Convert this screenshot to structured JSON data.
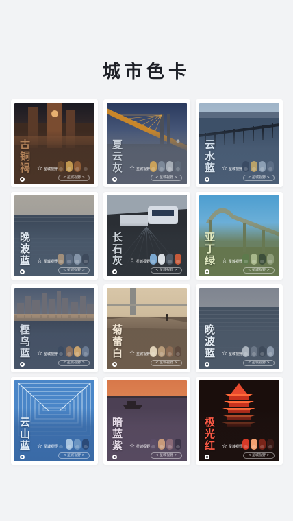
{
  "page": {
    "title": "城市色卡"
  },
  "brand": {
    "logo_text": "星城视野",
    "pill_text": "< 星城视野 >"
  },
  "cards": [
    {
      "name": "古铜褐",
      "text_color": "#b3835a",
      "swatches": [
        "#6b4a2e",
        "#c0974f",
        "#8d5b36",
        "#4a3325"
      ],
      "sky_top": "#1a1a22",
      "sky_bottom": "#6a4a3a",
      "ground": "#3d2a20",
      "overlay": "#4a3427",
      "icon": "clock-tower-scene"
    },
    {
      "name": "夏云灰",
      "text_color": "#c7cfd8",
      "swatches": [
        "#c9a15a",
        "#7c8898",
        "#a6adb6",
        "#5f6978"
      ],
      "sky_top": "#2a3a5e",
      "sky_bottom": "#7c8ca8",
      "ground": "#46505e",
      "overlay": "#5a6170",
      "icon": "bridge-scene"
    },
    {
      "name": "云水蓝",
      "text_color": "#d6e2ee",
      "swatches": [
        "#3a4b63",
        "#b8a169",
        "#8c9fb4",
        "#5b6d85"
      ],
      "sky_top": "#9fb4c8",
      "sky_bottom": "#cdd8e2",
      "ground": "#3d5068",
      "overlay": "#4a5d75",
      "icon": "pier-scene"
    },
    {
      "name": "晚波蓝",
      "text_color": "#e4ecf4",
      "swatches": [
        "#a08e7a",
        "#5c6b80",
        "#8494a8",
        "#3e4a5c"
      ],
      "sky_top": "#a8a49c",
      "sky_bottom": "#8d8f92",
      "ground": "#3e4b5c",
      "overlay": "#4b5a6c",
      "icon": "water-scene"
    },
    {
      "name": "长石灰",
      "text_color": "#cfd6dc",
      "swatches": [
        "#7ba8d0",
        "#d8dde2",
        "#4f5a66",
        "#c65a3a"
      ],
      "sky_top": "#1a1e24",
      "sky_bottom": "#5e6670",
      "ground": "#2a2e34",
      "overlay": "#2f343a",
      "icon": "metro-scene"
    },
    {
      "name": "亚丁绿",
      "text_color": "#dfe8c0",
      "swatches": [
        "#5d7a4c",
        "#a7b78a",
        "#3c4f3a",
        "#8d9c78"
      ],
      "sky_top": "#4d9ed0",
      "sky_bottom": "#a6cfe6",
      "ground": "#5c6e4a",
      "overlay": "#66774f",
      "icon": "viaduct-scene"
    },
    {
      "name": "樫鸟蓝",
      "text_color": "#d3dbe6",
      "swatches": [
        "#3d4c62",
        "#8a7160",
        "#c9a36d",
        "#6a7a92"
      ],
      "sky_top": "#4c5a70",
      "sky_bottom": "#a8a2a0",
      "ground": "#3b4556",
      "overlay": "#475468",
      "icon": "skyline-scene"
    },
    {
      "name": "菊蕾白",
      "text_color": "#f0e4d2",
      "swatches": [
        "#e0d2b8",
        "#b89c7a",
        "#8c6c54",
        "#5e4a3e"
      ],
      "sky_top": "#d8c6a8",
      "sky_bottom": "#bca886",
      "ground": "#6a5a4a",
      "overlay": "#6d5c4c",
      "icon": "riverside-scene"
    },
    {
      "name": "晚波蓝",
      "text_color": "#e4ecf4",
      "swatches": [
        "#a9b2bc",
        "#6a7686",
        "#3f4b5b",
        "#8896a8"
      ],
      "sky_top": "#7f8590",
      "sky_bottom": "#a2a4a8",
      "ground": "#455262",
      "overlay": "#4c5969",
      "icon": "water-scene"
    },
    {
      "name": "云山蓝",
      "text_color": "#e2eef8",
      "swatches": [
        "#3a6da8",
        "#a6c4e0",
        "#6b95c2",
        "#2a4a78"
      ],
      "sky_top": "#4a86c8",
      "sky_bottom": "#8ab8e4",
      "ground": "#2f5c94",
      "overlay": "#3a6aa6",
      "icon": "truss-scene"
    },
    {
      "name": "暗蓝紫",
      "text_color": "#e6dce8",
      "swatches": [
        "#5a4c66",
        "#c89a7a",
        "#8a6a78",
        "#3c3448"
      ],
      "sky_top": "#d8784a",
      "sky_bottom": "#e8a46a",
      "ground": "#4c4054",
      "overlay": "#574a60",
      "icon": "sunset-scene"
    },
    {
      "name": "极光红",
      "text_color": "#ff5a46",
      "swatches": [
        "#d83a28",
        "#f2a070",
        "#7a2418",
        "#3a1a16"
      ],
      "sky_top": "#0c0808",
      "sky_bottom": "#2a1410",
      "ground": "#1a0e0c",
      "overlay": "#1c110f",
      "icon": "tower-scene"
    }
  ]
}
